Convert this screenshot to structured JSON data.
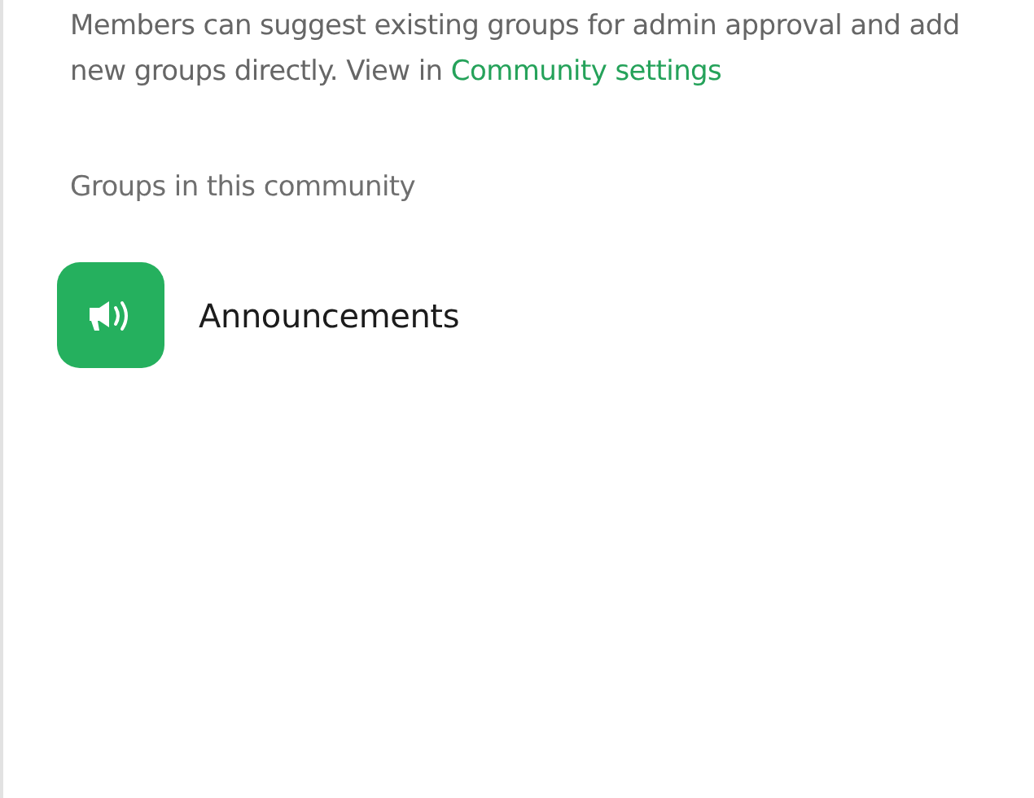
{
  "description": {
    "text": "Members can suggest existing groups for admin approval and add new groups directly. View in",
    "link": "Community settings"
  },
  "section_title": "Groups in this community",
  "groups": [
    {
      "name": "Announcements",
      "kind": "announcement"
    }
  ]
}
